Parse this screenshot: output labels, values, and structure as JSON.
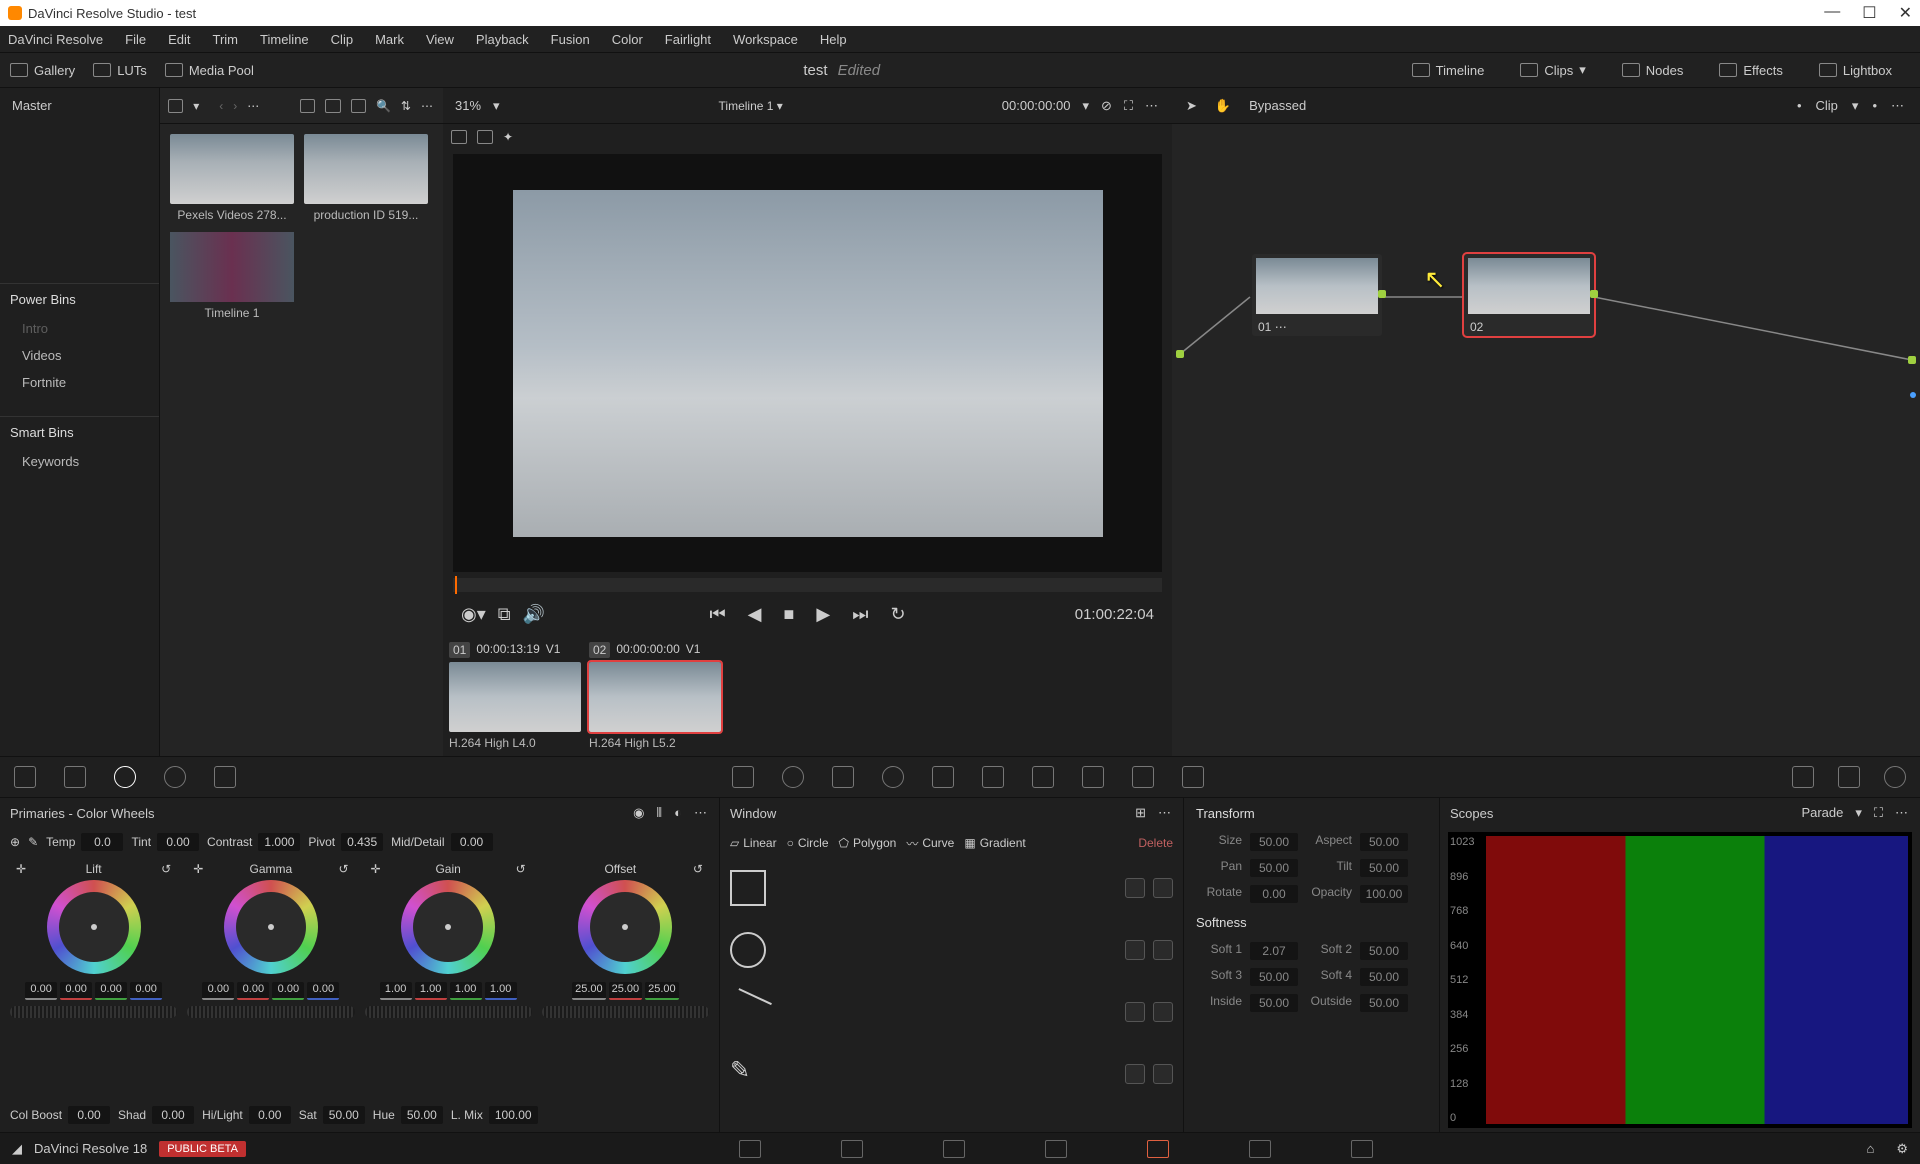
{
  "title": "DaVinci Resolve Studio - test",
  "menu": [
    "DaVinci Resolve",
    "File",
    "Edit",
    "Trim",
    "Timeline",
    "Clip",
    "Mark",
    "View",
    "Playback",
    "Fusion",
    "Color",
    "Fairlight",
    "Workspace",
    "Help"
  ],
  "toolbar": {
    "gallery": "Gallery",
    "luts": "LUTs",
    "mediapool": "Media Pool",
    "project": "test",
    "edited": "Edited",
    "timeline": "Timeline",
    "clips": "Clips",
    "nodes": "Nodes",
    "effects": "Effects",
    "lightbox": "Lightbox"
  },
  "media": {
    "master": "Master",
    "powerbins": "Power Bins",
    "bins": [
      "Intro",
      "Videos",
      "Fortnite"
    ],
    "smartbins": "Smart Bins",
    "smart": [
      "Keywords"
    ]
  },
  "clipsbar": {
    "zoom": "31%"
  },
  "thumbs": [
    {
      "label": "Pexels Videos 278..."
    },
    {
      "label": "production ID 519..."
    },
    {
      "label": "Timeline 1"
    }
  ],
  "viewer": {
    "timeline": "Timeline 1",
    "timecode": "00:00:00:00",
    "duration": "01:00:22:04"
  },
  "nodes": {
    "bypassed": "Bypassed",
    "clip": "Clip",
    "n1": "01",
    "n2": "02"
  },
  "clips": [
    {
      "num": "01",
      "tc": "00:00:13:19",
      "v": "V1",
      "codec": "H.264 High L4.0"
    },
    {
      "num": "02",
      "tc": "00:00:00:00",
      "v": "V1",
      "codec": "H.264 High L5.2"
    }
  ],
  "primaries": {
    "title": "Primaries - Color Wheels",
    "row1": [
      [
        "Temp",
        "0.0"
      ],
      [
        "Tint",
        "0.00"
      ],
      [
        "Contrast",
        "1.000"
      ],
      [
        "Pivot",
        "0.435"
      ],
      [
        "Mid/Detail",
        "0.00"
      ]
    ],
    "wheels": [
      {
        "name": "Lift",
        "vals": [
          "0.00",
          "0.00",
          "0.00",
          "0.00"
        ]
      },
      {
        "name": "Gamma",
        "vals": [
          "0.00",
          "0.00",
          "0.00",
          "0.00"
        ]
      },
      {
        "name": "Gain",
        "vals": [
          "1.00",
          "1.00",
          "1.00",
          "1.00"
        ]
      },
      {
        "name": "Offset",
        "vals": [
          "25.00",
          "25.00",
          "25.00"
        ]
      }
    ],
    "row2": [
      [
        "Col Boost",
        "0.00"
      ],
      [
        "Shad",
        "0.00"
      ],
      [
        "Hi/Light",
        "0.00"
      ],
      [
        "Sat",
        "50.00"
      ],
      [
        "Hue",
        "50.00"
      ],
      [
        "L. Mix",
        "100.00"
      ]
    ]
  },
  "window": {
    "title": "Window",
    "tools": [
      "Linear",
      "Circle",
      "Polygon",
      "Curve",
      "Gradient"
    ],
    "delete": "Delete"
  },
  "transform": {
    "title": "Transform",
    "rows": [
      [
        "Size",
        "50.00",
        "Aspect",
        "50.00"
      ],
      [
        "Pan",
        "50.00",
        "Tilt",
        "50.00"
      ],
      [
        "Rotate",
        "0.00",
        "Opacity",
        "100.00"
      ]
    ],
    "soft_title": "Softness",
    "soft": [
      [
        "Soft 1",
        "2.07",
        "Soft 2",
        "50.00"
      ],
      [
        "Soft 3",
        "50.00",
        "Soft 4",
        "50.00"
      ],
      [
        "Inside",
        "50.00",
        "Outside",
        "50.00"
      ]
    ]
  },
  "scopes": {
    "title": "Scopes",
    "mode": "Parade",
    "ticks": [
      "1023",
      "896",
      "768",
      "640",
      "512",
      "384",
      "256",
      "128",
      "0"
    ]
  },
  "status": {
    "app": "DaVinci Resolve 18",
    "beta": "PUBLIC BETA"
  }
}
